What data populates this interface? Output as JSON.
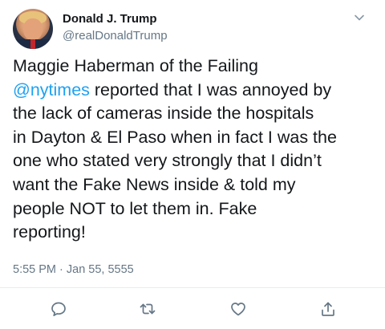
{
  "author": {
    "name": "Donald J. Trump",
    "handle": "@realDonaldTrump"
  },
  "tweet": {
    "mention": "@nytimes",
    "lines": [
      "Maggie Haberman of the Failing",
      " reported that I was annoyed by",
      "the lack of cameras inside the hospitals",
      "in Dayton & El Paso when in fact I was the",
      "one who stated very strongly that I didn’t",
      "want the Fake News inside & told my",
      "people NOT to let them in. Fake",
      "reporting!"
    ],
    "timestamp": "5:55 PM · Jan 55, 5555"
  },
  "icons": {
    "menu": "chevron-down-icon",
    "reply": "reply-icon",
    "retweet": "retweet-icon",
    "like": "heart-icon",
    "share": "share-icon"
  },
  "colors": {
    "accent": "#1da1f2",
    "secondary_text": "#657786",
    "primary_text": "#14171a",
    "divider": "#e6ecf0"
  }
}
